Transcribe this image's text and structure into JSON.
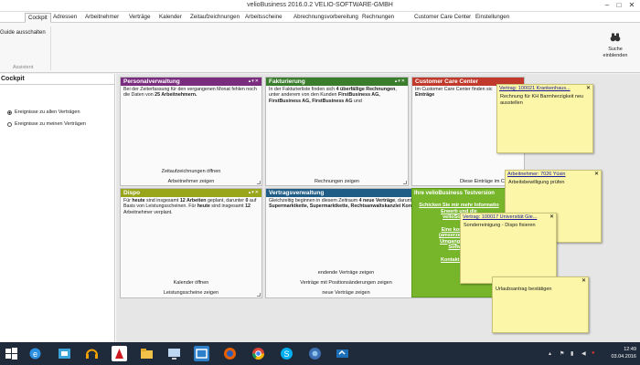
{
  "window": {
    "title": "velioBusiness   2016.0.2  VELIO-SOFTWARE-GMBH"
  },
  "tabs": [
    "Cockpit",
    "Adressen",
    "Arbeitnehmer",
    "Verträge",
    "Kalender",
    "Zeitaufzeichnungen",
    "Arbeitsscheine",
    "Abrechnungsvorbereitung",
    "Rechnungen",
    "Customer Care Center",
    "Einstellungen"
  ],
  "ribbon": {
    "guide_label": "Guide ausschalten",
    "group_label": "Assistent",
    "search_label_1": "Suche",
    "search_label_2": "einblenden"
  },
  "left_panel": {
    "title": "Cockpit",
    "options": [
      "Ereignisse zu allen Verträgen",
      "Ereignisse zu meinen Verträgen"
    ],
    "selected": 0
  },
  "cards": {
    "personal": {
      "title": "Personalverwaltung",
      "color": "#7a2c7f",
      "text_a": "Bei der Zeiterfassung für den vergangenen Monat fehlen noch die Daten von ",
      "text_b": "25 Arbeitnehmern.",
      "link1": "Zeitaufzeichnungen öffnen",
      "link2": "Arbeitnehmer zeigen"
    },
    "faktur": {
      "title": "Fakturierung",
      "color": "#3a7d2c",
      "text_a": "In der Fakturierliste finden sich ",
      "text_b": "4 überfällige Rechnungen",
      "text_c": ", unter anderem von den Kunden ",
      "text_d": "FirstBusiness AG, FirstBusiness AG, FirstBusiness AG",
      "text_e": " und ",
      "link1": "Rechnungen zeigen"
    },
    "ccc": {
      "title": "Customer Care Center",
      "color": "#c0392b",
      "text_a": "Im Customer Care Center finden sic",
      "text_b": "Einträge",
      "link1": "Diese Einträge im CCC z"
    },
    "dispo": {
      "title": "Dispo",
      "color": "#9aa61a",
      "text": [
        "Für ",
        "heute",
        " sind insgesamt ",
        "12 Arbeiten",
        " geplant, darunter ",
        "0",
        " auf Basis von Leistungsscheinen. Für ",
        "heute",
        " sind insgesamt ",
        "12",
        "  Arbeitnehmer verplant."
      ],
      "link1": "Kalender öffnen",
      "link2": "Leistungsscheine zeigen"
    },
    "vertrag": {
      "title": "Vertragsverwaltung",
      "color": "#1f5d87",
      "text_a": "Gleichzeitig beginnen in diesem Zeitraum ",
      "text_b": "4 neue Verträge",
      "text_c": ", darunter ",
      "text_d": "Supermarktkette, Supermarktkette, Rechtsanwaltskanzlei Korrekt",
      "text_e": " und",
      "link1": "endende Verträge zeigen",
      "link2": "Verträge mit Positionsänderungen zeigen",
      "link3": "neue Verträge zeigen"
    },
    "green": {
      "title": "Ihre velioBusiness Testversion",
      "line1": "Schicken Sie mir mehr Informatio",
      "line2": "Erwerb und die",
      "line3": "velioSoftware",
      "line4": "Eine kostenlos",
      "line5": "(amserzeitarbeit)",
      "line6": "Umgang mit der",
      "line7": "Software",
      "line8": "Kontakt aufneh"
    }
  },
  "notes": [
    {
      "id": "n1",
      "title": "Vertrag: 100021 Krankenhaus...",
      "body": "Rechnung für KH Barmherzigkeit neu ausstellen"
    },
    {
      "id": "n2",
      "title": "Arbeitnehmer: 7026 Yüsin",
      "body": "Arbeitsbewilligung prüfen"
    },
    {
      "id": "n3",
      "title": "Vertrag: 100017 Universität Gie...",
      "body": "Sonderreinigung - Dispo fixieren"
    },
    {
      "id": "n4",
      "title": "",
      "body": "Urlaubsantrag bestätigen"
    }
  ],
  "taskbar": {
    "time": "12:49",
    "date": "03.04.2016",
    "icons": [
      "windows-start-icon",
      "internet-explorer-icon",
      "store-icon",
      "headphones-icon",
      "adobe-icon",
      "explorer-folder-icon",
      "monitor-icon",
      "network-icon",
      "firefox-icon",
      "chrome-icon",
      "skype-icon",
      "globe-icon",
      "remote-icon"
    ]
  }
}
